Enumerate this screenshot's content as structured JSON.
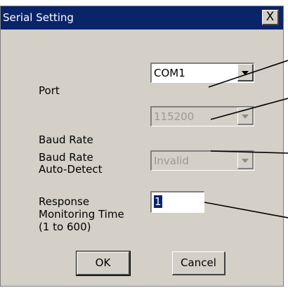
{
  "window": {
    "title": "Serial Setting",
    "close_label": "X"
  },
  "fields": {
    "port": {
      "label": "Port",
      "value": "COM1"
    },
    "baud_rate": {
      "label": "Baud Rate",
      "value": "115200"
    },
    "auto_detect": {
      "label_line1": "Baud Rate",
      "label_line2": "Auto-Detect",
      "value": "Invalid"
    },
    "response_time": {
      "label_line1": "Response",
      "label_line2": "Monitoring Time",
      "label_line3": "(1 to 600)",
      "value": "1"
    }
  },
  "buttons": {
    "ok": "OK",
    "cancel": "Cancel"
  }
}
